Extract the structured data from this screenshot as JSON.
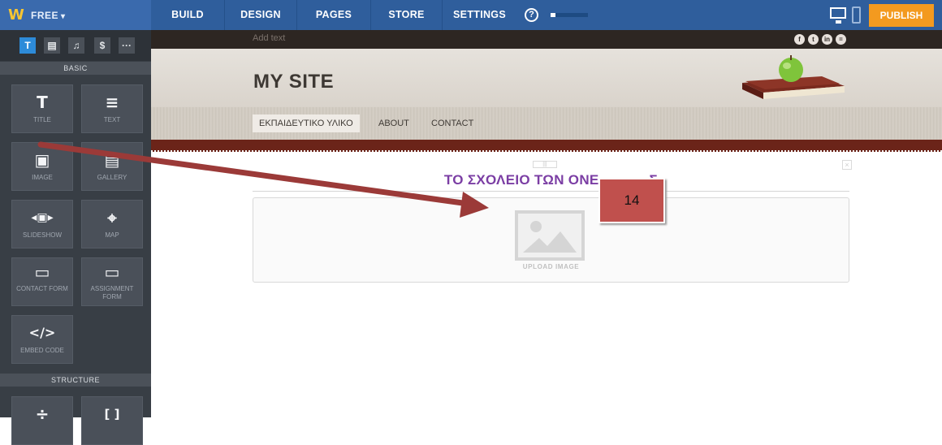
{
  "topbar": {
    "logo": "W",
    "plan": "FREE",
    "caret": "▾",
    "nav": [
      "BUILD",
      "DESIGN",
      "PAGES",
      "STORE",
      "SETTINGS"
    ],
    "help": "?",
    "progress_fraction": 0.12,
    "publish": "PUBLISH"
  },
  "sidebar": {
    "tabs": [
      "T",
      "▤",
      "♫",
      "$",
      "···"
    ],
    "section_basic": "BASIC",
    "section_structure": "STRUCTURE",
    "tiles": [
      {
        "icon": "T",
        "label": "TITLE"
      },
      {
        "icon": "≡",
        "label": "TEXT"
      },
      {
        "icon": "▣",
        "label": "IMAGE"
      },
      {
        "icon": "▤",
        "label": "GALLERY"
      },
      {
        "icon": "◂▣▸",
        "label": "SLIDESHOW"
      },
      {
        "icon": "⌖",
        "label": "MAP"
      },
      {
        "icon": "▭",
        "label": "CONTACT FORM"
      },
      {
        "icon": "▭",
        "label": "ASSIGNMENT FORM"
      },
      {
        "icon": "</>",
        "label": "EMBED CODE"
      },
      {
        "icon": "÷",
        "label": ""
      },
      {
        "icon": "[ ]",
        "label": ""
      }
    ]
  },
  "site": {
    "add_text": "Add text",
    "social": [
      "f",
      "t",
      "in",
      "="
    ],
    "title": "MY SITE",
    "nav": [
      "ΕΚΠΑΙΔΕΥΤΙΚΟ ΥΛΙΚΟ",
      "ABOUT",
      "CONTACT"
    ],
    "heading": "ΤΟ ΣΧΟΛΕΙΟ ΤΩΝ ΟΝΕ",
    "heading_tail": "Σ",
    "upload_label": "UPLOAD IMAGE",
    "handle": "|||",
    "close": "×"
  },
  "callout": {
    "label": "14"
  },
  "colors": {
    "topbar": "#2f5e9c",
    "sidebar": "#383e45",
    "accent": "#2d8bd9",
    "publish": "#f39a1f",
    "heading": "#7b3ea4",
    "arrow": "#9b3a38",
    "callout": "#c0504d"
  }
}
